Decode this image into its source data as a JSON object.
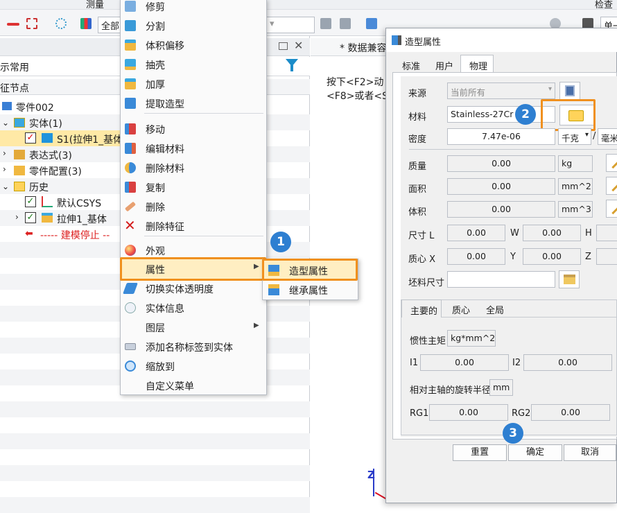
{
  "toolbar": {
    "top_items": [
      "测量",
      "检查"
    ],
    "combo_left": "全部",
    "combo_right": "单一"
  },
  "tree": {
    "filter_text": "示常用",
    "header": "征节点",
    "items": [
      {
        "label": "零件002"
      },
      {
        "label": "实体(1)"
      },
      {
        "label": "S1(拉伸1_基体"
      },
      {
        "label": "表达式(3)"
      },
      {
        "label": "零件配置(3)"
      },
      {
        "label": "历史"
      },
      {
        "label": "默认CSYS"
      },
      {
        "label": "拉伸1_基体"
      },
      {
        "label": "----- 建模停止 --"
      }
    ]
  },
  "canvas": {
    "tab_label": "* 数据兼容",
    "hint_line1": "按下<F2>动",
    "hint_line2": "<F8>或者<S",
    "axis_label": "Z"
  },
  "context_menu": {
    "items": [
      {
        "label": "修剪"
      },
      {
        "label": "分割"
      },
      {
        "label": "体积偏移"
      },
      {
        "label": "抽壳"
      },
      {
        "label": "加厚"
      },
      {
        "label": "提取造型"
      },
      {
        "label": "移动"
      },
      {
        "label": "编辑材料"
      },
      {
        "label": "删除材料"
      },
      {
        "label": "复制"
      },
      {
        "label": "删除"
      },
      {
        "label": "删除特征"
      },
      {
        "label": "外观"
      },
      {
        "label": "属性"
      },
      {
        "label": "切换实体透明度"
      },
      {
        "label": "实体信息"
      },
      {
        "label": "图层"
      },
      {
        "label": "添加名称标签到实体"
      },
      {
        "label": "缩放到"
      },
      {
        "label": "自定义菜单"
      }
    ]
  },
  "submenu": {
    "items": [
      {
        "label": "造型属性"
      },
      {
        "label": "继承属性"
      }
    ]
  },
  "steps": [
    "1",
    "2",
    "3"
  ],
  "dialog": {
    "title": "造型属性",
    "tabs": [
      "标准",
      "用户",
      "物理"
    ],
    "source_label": "来源",
    "source_value": "当前所有",
    "material_label": "材料",
    "material_value": "Stainless-27Cr",
    "density_label": "密度",
    "density_value": "7.47e-06",
    "density_unit_mass": "千克",
    "density_unit_sep": "/",
    "density_unit_len": "毫米",
    "mass_label": "质量",
    "mass_value": "0.00",
    "mass_unit": "kg",
    "area_label": "面积",
    "area_value": "0.00",
    "area_unit": "mm^2",
    "volume_label": "体积",
    "volume_value": "0.00",
    "volume_unit": "mm^3",
    "size_label": "尺寸 L",
    "size_l": "0.00",
    "size_w_label": "W",
    "size_w": "0.00",
    "size_h_label": "H",
    "centroid_label": "质心 X",
    "centroid_x": "0.00",
    "centroid_y_label": "Y",
    "centroid_y": "0.00",
    "centroid_z_label": "Z",
    "stock_label": "坯料尺寸",
    "stock_value": "",
    "lower_tabs": [
      "主要的",
      "质心",
      "全局"
    ],
    "inertia_label": "惯性主矩",
    "inertia_unit": "kg*mm^2",
    "i1_label": "I1",
    "i1_value": "0.00",
    "i2_label": "I2",
    "i2_value": "0.00",
    "radius_label": "相对主轴的旋转半径",
    "radius_unit": "mm",
    "rg1_label": "RG1",
    "rg1_value": "0.00",
    "rg2_label": "RG2",
    "rg2_value": "0.00",
    "buttons": {
      "reset": "重置",
      "ok": "确定",
      "cancel": "取消"
    }
  },
  "colors": {
    "accent_orange": "#f0901e",
    "step_blue": "#2e7fd1",
    "selection_yellow": "#ffe9a6"
  }
}
